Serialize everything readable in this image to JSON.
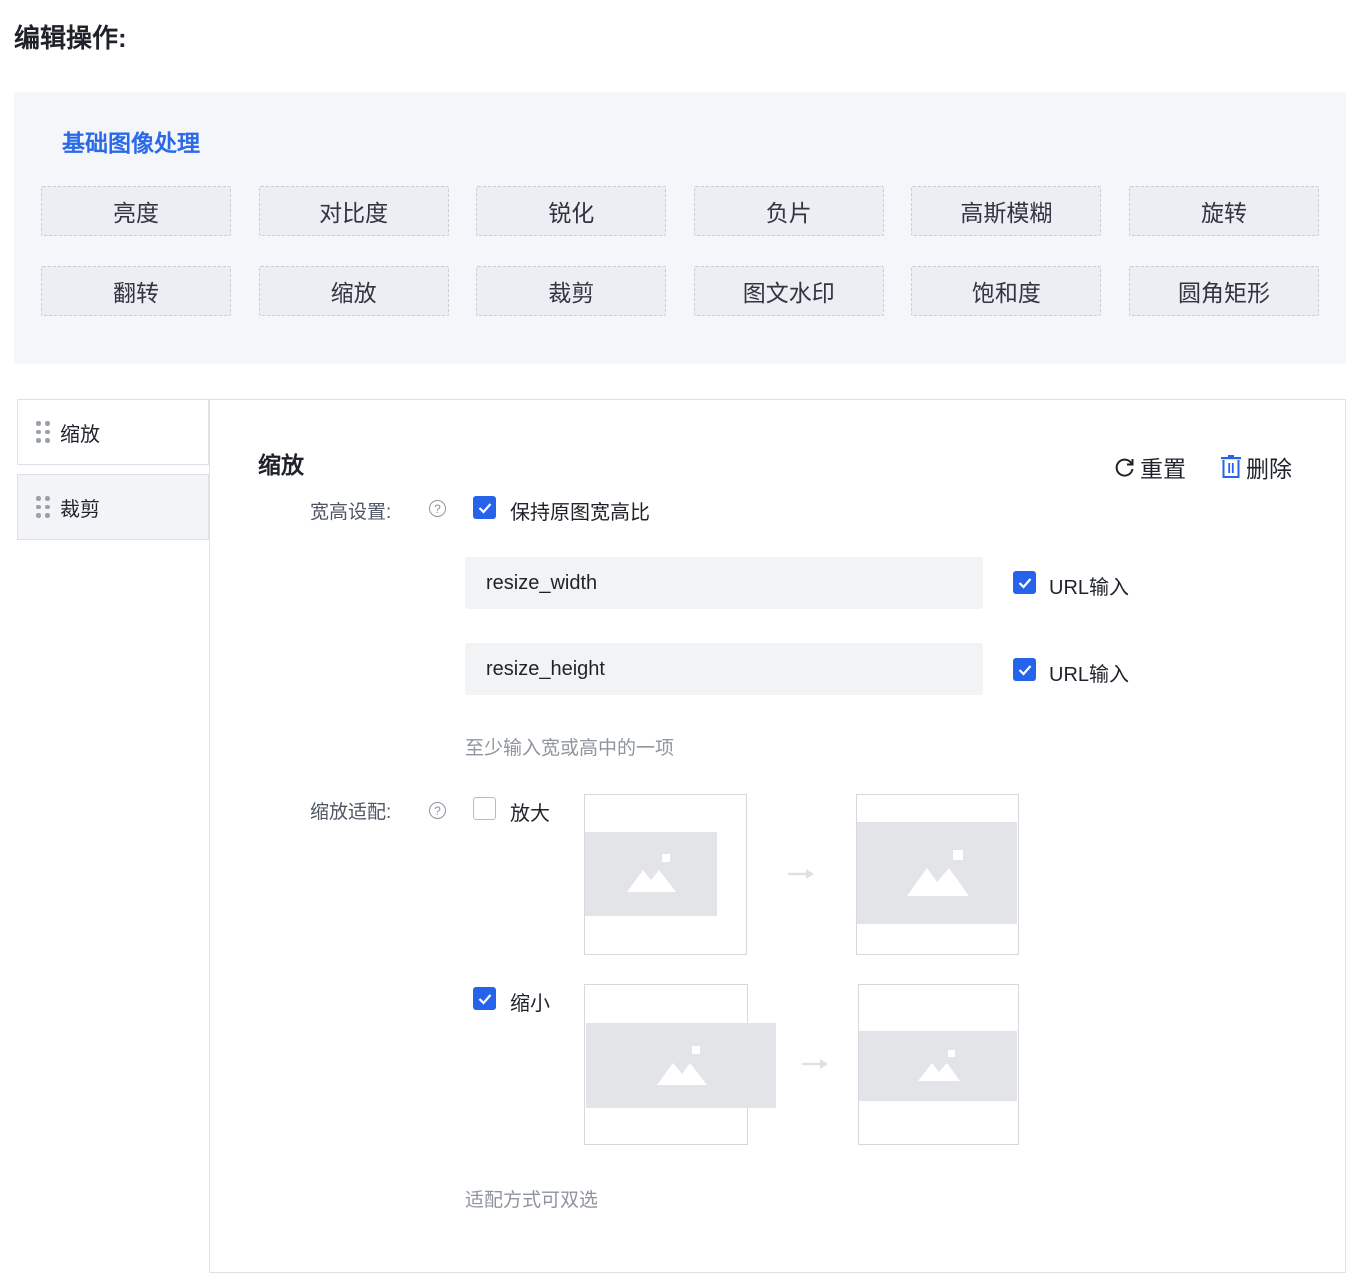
{
  "page": {
    "title": "编辑操作:"
  },
  "ops": {
    "group_title": "基础图像处理",
    "buttons": [
      "亮度",
      "对比度",
      "锐化",
      "负片",
      "高斯模糊",
      "旋转",
      "翻转",
      "缩放",
      "裁剪",
      "图文水印",
      "饱和度",
      "圆角矩形"
    ]
  },
  "sidebar": {
    "items": [
      {
        "label": "缩放"
      },
      {
        "label": "裁剪"
      }
    ]
  },
  "detail": {
    "title": "缩放",
    "reset_label": "重置",
    "delete_label": "删除",
    "size_label": "宽高设置:",
    "keep_ratio": {
      "label": "保持原图宽高比",
      "checked": true
    },
    "width_input": {
      "value": "resize_width",
      "url_label": "URL输入",
      "url_checked": true
    },
    "height_input": {
      "value": "resize_height",
      "url_label": "URL输入",
      "url_checked": true
    },
    "size_hint": "至少输入宽或高中的一项",
    "fit_label": "缩放适配:",
    "enlarge": {
      "label": "放大",
      "checked": false
    },
    "shrink": {
      "label": "缩小",
      "checked": true
    },
    "fit_hint": "适配方式可双选",
    "help_glyph": "?"
  },
  "colors": {
    "accent": "#2563eb",
    "title_blue": "#2a6ae8",
    "panel_bg": "#f5f6fa"
  }
}
